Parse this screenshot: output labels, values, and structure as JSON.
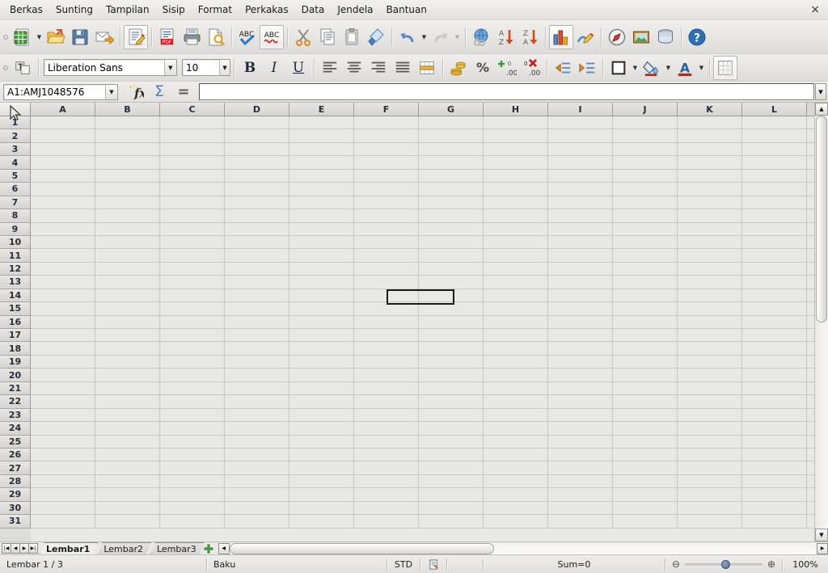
{
  "menubar": {
    "items": [
      {
        "label": "Berkas",
        "accel": "B"
      },
      {
        "label": "Sunting",
        "accel": "S"
      },
      {
        "label": "Tampilan",
        "accel": "m"
      },
      {
        "label": "Sisip",
        "accel": "i"
      },
      {
        "label": "Format",
        "accel": "o"
      },
      {
        "label": "Perkakas",
        "accel": "k"
      },
      {
        "label": "Data",
        "accel": "D"
      },
      {
        "label": "Jendela",
        "accel": "J"
      },
      {
        "label": "Bantuan",
        "accel": "n"
      }
    ],
    "close_label": "×"
  },
  "standard_toolbar": {
    "buttons": [
      {
        "name": "new-document",
        "icon": "new-spreadsheet-icon",
        "state": "enabled"
      },
      {
        "name": "new-dropdown",
        "icon": "chevron-down-icon",
        "state": "enabled"
      },
      {
        "name": "open-document",
        "icon": "open-folder-icon",
        "state": "enabled"
      },
      {
        "name": "save-document",
        "icon": "floppy-disk-icon",
        "state": "enabled"
      },
      {
        "name": "send-email",
        "icon": "envelope-arrow-icon",
        "state": "enabled"
      },
      {
        "name": "edit-mode",
        "icon": "document-pencil-icon",
        "state": "active"
      },
      {
        "name": "export-pdf",
        "icon": "pdf-icon",
        "state": "enabled"
      },
      {
        "name": "print-file",
        "icon": "printer-icon",
        "state": "enabled"
      },
      {
        "name": "print-preview",
        "icon": "magnifier-page-icon",
        "state": "enabled"
      },
      {
        "name": "spelling-check",
        "icon": "abc-check-icon",
        "state": "enabled"
      },
      {
        "name": "autospellcheck",
        "icon": "abc-wave-icon",
        "state": "active"
      },
      {
        "name": "cut",
        "icon": "scissors-icon",
        "state": "enabled"
      },
      {
        "name": "copy",
        "icon": "copy-pages-icon",
        "state": "enabled"
      },
      {
        "name": "paste",
        "icon": "clipboard-icon",
        "state": "enabled"
      },
      {
        "name": "clone-formatting",
        "icon": "paintbrush-icon",
        "state": "enabled"
      },
      {
        "name": "undo",
        "icon": "undo-arrow-icon",
        "state": "enabled"
      },
      {
        "name": "undo-dropdown",
        "icon": "chevron-down-icon",
        "state": "enabled"
      },
      {
        "name": "redo",
        "icon": "redo-arrow-icon",
        "state": "disabled"
      },
      {
        "name": "redo-dropdown",
        "icon": "chevron-down-icon",
        "state": "disabled"
      },
      {
        "name": "hyperlink",
        "icon": "globe-chain-icon",
        "state": "enabled"
      },
      {
        "name": "sort-ascending",
        "icon": "sort-az-icon",
        "state": "enabled"
      },
      {
        "name": "sort-descending",
        "icon": "sort-za-icon",
        "state": "enabled"
      },
      {
        "name": "insert-chart",
        "icon": "bar-chart-icon",
        "state": "enabled"
      },
      {
        "name": "show-draw-functions",
        "icon": "draw-pencil-icon",
        "state": "enabled"
      },
      {
        "name": "navigator",
        "icon": "compass-icon",
        "state": "enabled"
      },
      {
        "name": "insert-image",
        "icon": "picture-icon",
        "state": "enabled"
      },
      {
        "name": "data-sources",
        "icon": "database-icon",
        "state": "enabled"
      },
      {
        "name": "help",
        "icon": "help-question-icon",
        "state": "enabled"
      }
    ]
  },
  "format_toolbar": {
    "styles_icon": "styles-and-formatting-icon",
    "font_name": "Liberation Sans",
    "font_size": "10",
    "buttons": [
      {
        "name": "bold",
        "icon": "bold-icon",
        "glyph": "B"
      },
      {
        "name": "italic",
        "icon": "italic-icon",
        "glyph": "I"
      },
      {
        "name": "underline",
        "icon": "underline-icon",
        "glyph": "U"
      },
      {
        "name": "align-left",
        "icon": "align-left-icon"
      },
      {
        "name": "align-center",
        "icon": "align-center-icon"
      },
      {
        "name": "align-right",
        "icon": "align-right-icon"
      },
      {
        "name": "align-justified",
        "icon": "align-justify-icon"
      },
      {
        "name": "merge-cells",
        "icon": "merge-cells-icon"
      },
      {
        "name": "format-currency",
        "icon": "coins-icon"
      },
      {
        "name": "format-percent",
        "icon": "percent-icon",
        "glyph": "%"
      },
      {
        "name": "add-decimal",
        "icon": "add-decimal-icon"
      },
      {
        "name": "delete-decimal",
        "icon": "delete-decimal-icon"
      },
      {
        "name": "decrease-indent",
        "icon": "decrease-indent-icon"
      },
      {
        "name": "increase-indent",
        "icon": "increase-indent-icon"
      },
      {
        "name": "borders",
        "icon": "borders-icon"
      },
      {
        "name": "borders-dropdown",
        "icon": "chevron-down-icon"
      },
      {
        "name": "background-color",
        "icon": "paint-can-icon"
      },
      {
        "name": "background-color-dropdown",
        "icon": "chevron-down-icon"
      },
      {
        "name": "font-color",
        "icon": "font-color-a-icon",
        "glyph": "A"
      },
      {
        "name": "font-color-dropdown",
        "icon": "chevron-down-icon"
      },
      {
        "name": "conditional-formatting",
        "icon": "grid-table-icon"
      }
    ]
  },
  "formula_bar": {
    "name_box_value": "A1:AMJ1048576",
    "name_box_dropdown_icon": "chevron-down-icon",
    "function_wizard_icon": "fx-icon",
    "sum_icon": "sigma-icon",
    "function_icon": "equals-icon",
    "input_value": "",
    "input_placeholder": "",
    "input_dropdown_icon": "chevron-down-icon"
  },
  "sheet": {
    "select_all_name": "select-all-corner",
    "columns": [
      "A",
      "B",
      "C",
      "D",
      "E",
      "F",
      "G",
      "H",
      "I",
      "J",
      "K",
      "L"
    ],
    "rows": [
      1,
      2,
      3,
      4,
      5,
      6,
      7,
      8,
      9,
      10,
      11,
      12,
      13,
      14,
      15,
      16,
      17,
      18,
      19,
      20,
      21,
      22,
      23,
      24,
      25,
      26,
      27,
      28,
      29,
      30,
      31
    ],
    "active_cell": "G14",
    "selection_state": "all-cells-selected",
    "cell_background": "#e8e8e6",
    "gridline_color": "#c9c8c5"
  },
  "sheet_tabs": {
    "nav_first_icon": "nav-first-icon",
    "nav_prev_icon": "nav-prev-icon",
    "nav_next_icon": "nav-next-icon",
    "nav_last_icon": "nav-last-icon",
    "tabs": [
      {
        "label": "Lembar1",
        "active": true
      },
      {
        "label": "Lembar2",
        "active": false
      },
      {
        "label": "Lembar3",
        "active": false
      }
    ],
    "add_sheet_icon": "add-sheet-plus-icon"
  },
  "statusbar": {
    "sheet_position": "Lembar 1 / 3",
    "page_style": "Baku",
    "selection_mode": "STD",
    "modified_icon": "document-modified-icon",
    "signature": "",
    "sum_info": "Sum=0",
    "zoom_out_icon": "zoom-out-icon",
    "zoom_in_icon": "zoom-in-icon",
    "zoom_level": "100%"
  }
}
